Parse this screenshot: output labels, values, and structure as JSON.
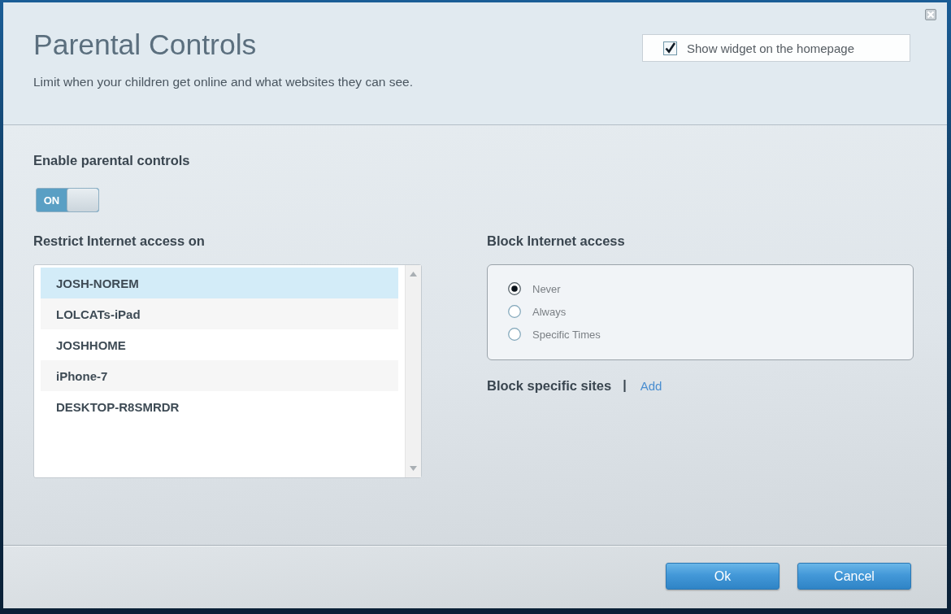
{
  "window": {
    "title": "Parental Controls",
    "subtitle": "Limit when your children get online and what websites they can see."
  },
  "widget": {
    "label": "Show widget on the homepage",
    "checked": true
  },
  "enable": {
    "label": "Enable parental controls",
    "toggle": {
      "label": "ON",
      "on": true
    }
  },
  "restrict": {
    "label": "Restrict Internet access on",
    "devices": [
      {
        "name": "JOSH-NOREM",
        "selected": true
      },
      {
        "name": "LOLCATs-iPad",
        "selected": false
      },
      {
        "name": "JOSHHOME",
        "selected": false
      },
      {
        "name": "iPhone-7",
        "selected": false
      },
      {
        "name": "DESKTOP-R8SMRDR",
        "selected": false
      }
    ]
  },
  "block": {
    "label": "Block Internet access",
    "options": [
      {
        "label": "Never",
        "selected": true
      },
      {
        "label": "Always",
        "selected": false
      },
      {
        "label": "Specific Times",
        "selected": false
      }
    ]
  },
  "block_sites": {
    "label": "Block specific sites",
    "separator": "|",
    "link": "Add"
  },
  "buttons": [
    "Ok",
    "Cancel"
  ]
}
